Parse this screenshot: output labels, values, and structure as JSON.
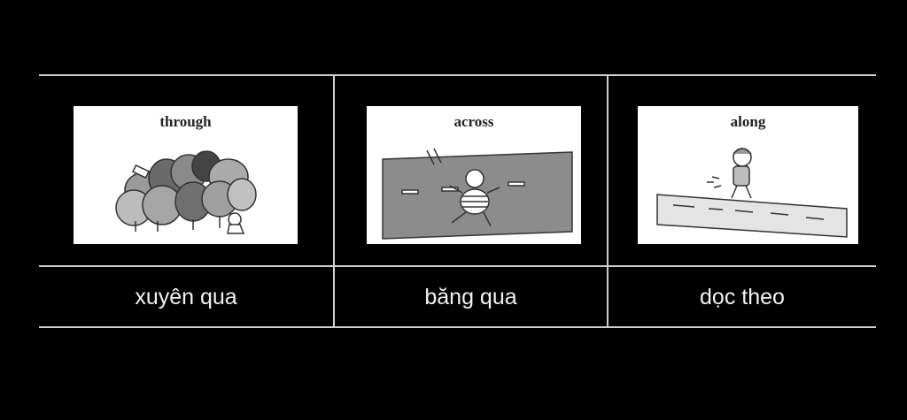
{
  "panels": [
    {
      "picture_caption": "through",
      "label": "xuyên qua",
      "icon": "trees-forest-illustration"
    },
    {
      "picture_caption": "across",
      "label": "băng qua",
      "icon": "road-crossing-illustration"
    },
    {
      "picture_caption": "along",
      "label": "dọc theo",
      "icon": "walking-along-path-illustration"
    }
  ],
  "colors": {
    "background": "#000000",
    "grid_line": "#cfcfcf",
    "label_text": "#f2f2f2",
    "picture_bg": "#ffffff"
  }
}
